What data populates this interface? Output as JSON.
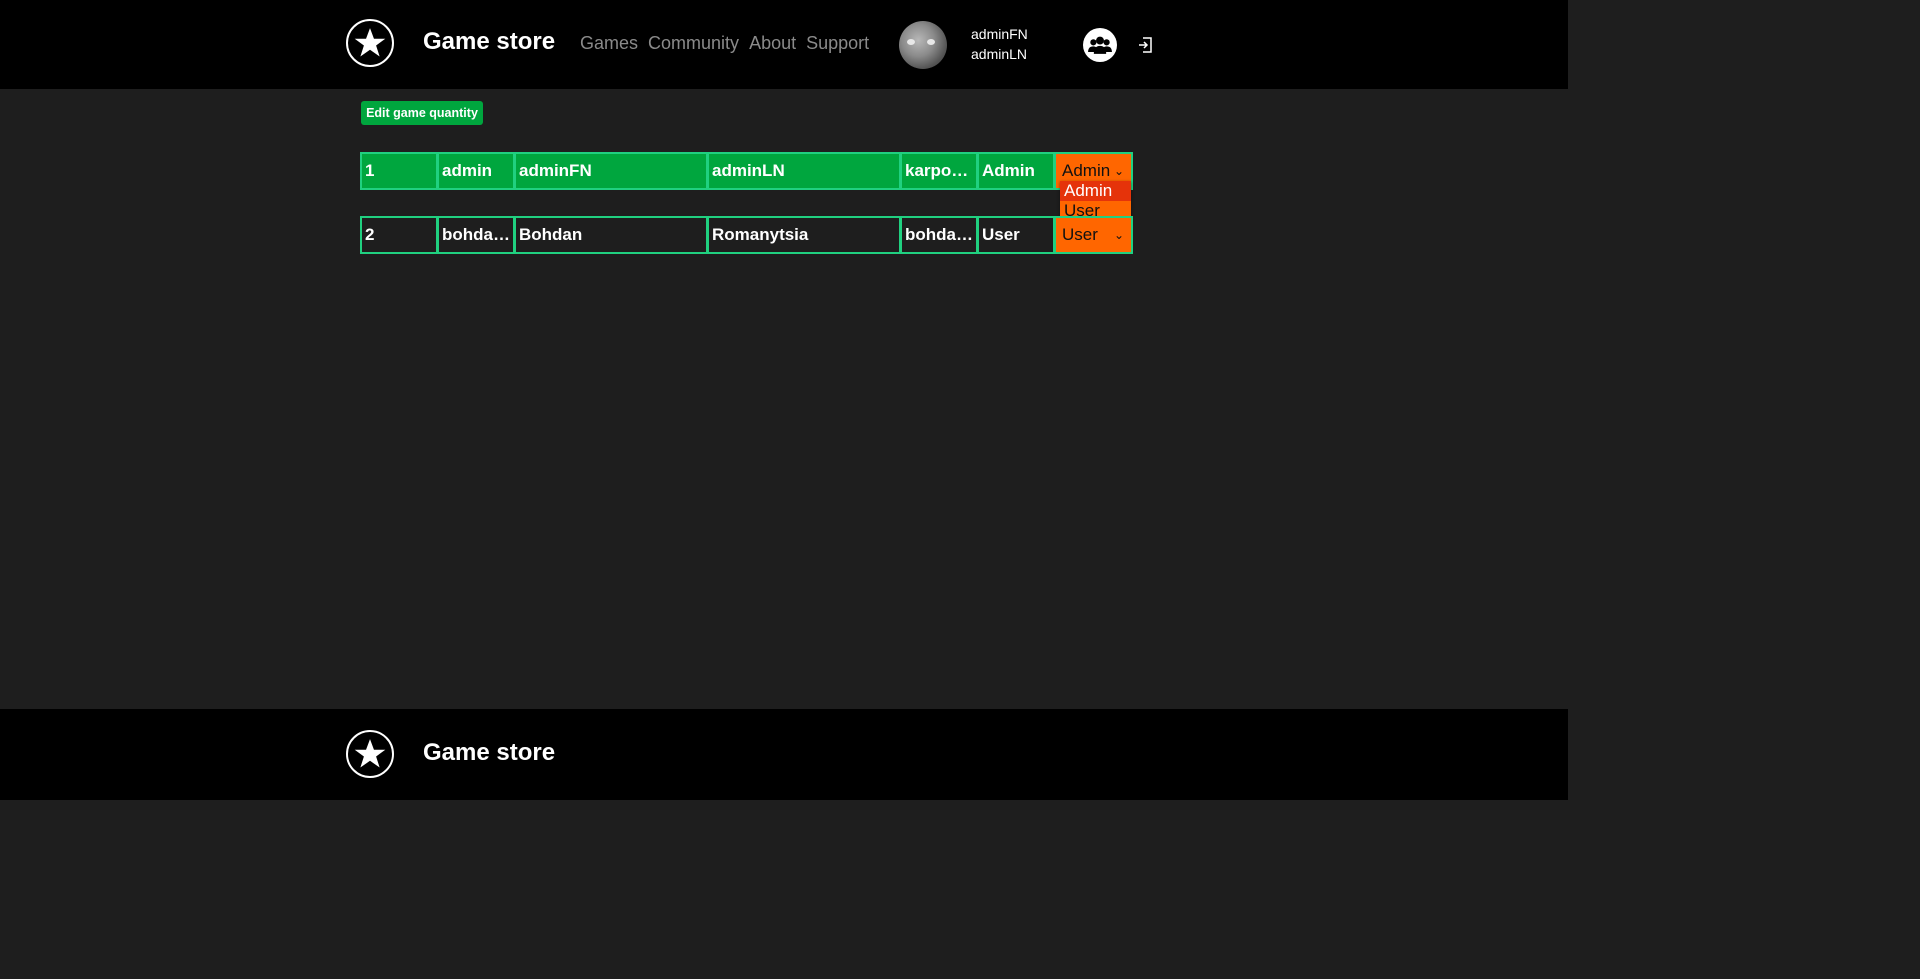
{
  "header": {
    "brand": "Game store",
    "nav": [
      "Games",
      "Community",
      "About",
      "Support"
    ],
    "user": {
      "first_name": "adminFN",
      "last_name": "adminLN"
    },
    "icons": {
      "logo": "star-icon",
      "community": "users-icon",
      "logout": "logout-icon"
    }
  },
  "toolbar": {
    "edit_label": "Edit game quantity"
  },
  "users": [
    {
      "id": "1",
      "username": "admin",
      "first_name": "adminFN",
      "last_name": "adminLN",
      "email": "karpov…",
      "role": "Admin",
      "selected_role": "Admin"
    },
    {
      "id": "2",
      "username": "bohda…",
      "first_name": "Bohdan",
      "last_name": "Romanytsia",
      "email": "bohda…",
      "role": "User",
      "selected_role": "User"
    }
  ],
  "role_options": [
    "Admin",
    "User"
  ],
  "footer": {
    "brand": "Game store"
  },
  "colors": {
    "accent": "#00a63e",
    "select": "#ff6600",
    "border": "#20d080",
    "header_bg": "#000000",
    "page_bg": "#1e1e1e"
  }
}
